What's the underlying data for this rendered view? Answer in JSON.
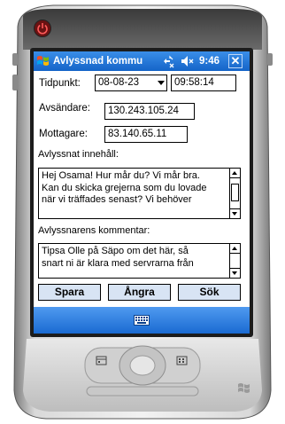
{
  "window": {
    "title": "Avlyssnad kommu",
    "clock": "9:46",
    "close_label": "✕"
  },
  "form": {
    "timestamp_label": "Tidpunkt:",
    "date_value": "08-08-23",
    "time_value": "09:58:14",
    "sender_label": "Avsändare:",
    "sender_value": "130.243.105.24",
    "recipient_label": "Mottagare:",
    "recipient_value": "83.140.65.11",
    "content_label": "Avlyssnat innehåll:",
    "content_lines": [
      "Hej Osama! Hur mår du? Vi mår bra.",
      "Kan du skicka grejerna som du lovade",
      "när vi träffades senast? Vi behöver"
    ],
    "comment_label": "Avlyssnarens kommentar:",
    "comment_lines": [
      "Tipsa Olle på Säpo om det här, så",
      "snart ni är klara med servrarna från"
    ]
  },
  "buttons": {
    "save": "Spara",
    "undo": "Ångra",
    "search": "Sök"
  },
  "colors": {
    "titlebar": "#1464c8",
    "menubar": "#1a6ad2",
    "button_bg": "#d8e4f4"
  },
  "icons": {
    "start": "windows-flag-icon",
    "connectivity": "connectivity-icon",
    "volume": "speaker-icon",
    "keyboard": "keyboard-icon",
    "power": "power-icon"
  }
}
